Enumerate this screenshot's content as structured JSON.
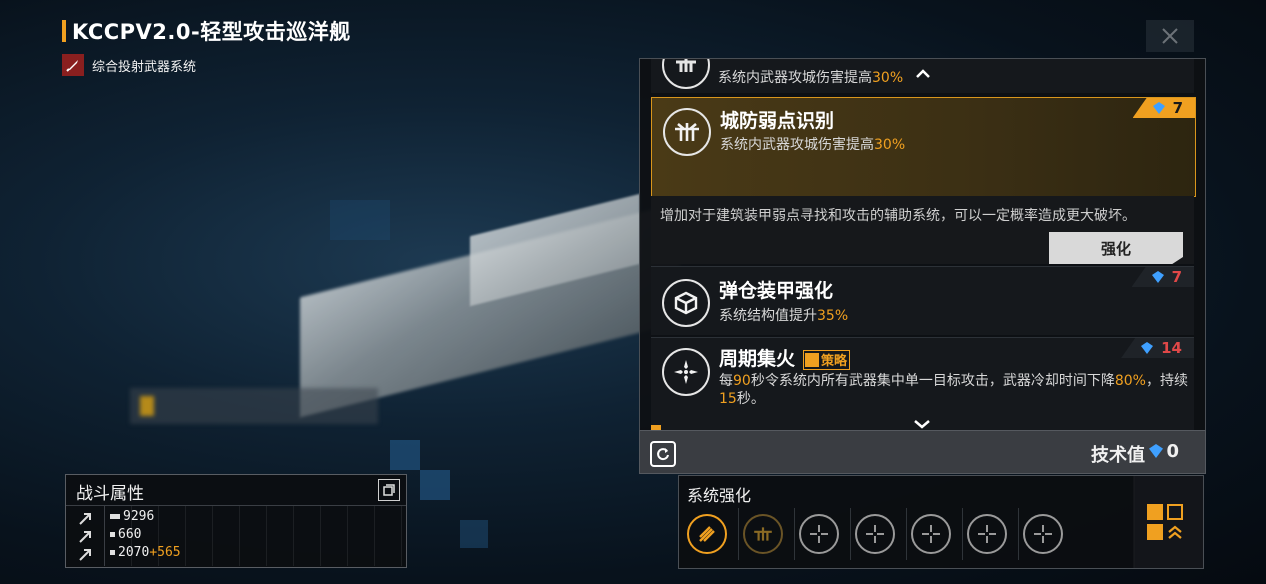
{
  "header": {
    "title": "KCCPV2.0-轻型攻击巡洋舰",
    "subtitle": "综合投射武器系统",
    "subtitle_icon": "missile-icon",
    "close_icon": "close-icon"
  },
  "skills_panel": {
    "prev_item": {
      "desc_prefix": "系统内武器攻城伤害提高",
      "desc_value": "30%"
    },
    "selected": {
      "name": "城防弱点识别",
      "desc_prefix": "系统内武器攻城伤害提高",
      "desc_value": "30%",
      "cost": "7",
      "long_desc": "增加对于建筑装甲弱点寻找和攻击的辅助系统，可以一定概率造成更大破坏。",
      "upgrade_label": "强化"
    },
    "items": [
      {
        "name": "弹仓装甲强化",
        "desc_prefix": "系统结构值提升",
        "desc_value": "35%",
        "cost": "7"
      },
      {
        "name": "周期集火",
        "tag": "策略",
        "cost": "14",
        "desc_1": "每",
        "desc_v1": "90",
        "desc_2": "秒令系统内所有武器集中单一目标攻击，武器冷却时间下降",
        "desc_v2": "80%",
        "desc_3": "，持续",
        "desc_v3": "15",
        "desc_4": "秒。"
      }
    ]
  },
  "tech_bar": {
    "label": "技术值",
    "value": "0",
    "refresh_icon": "refresh-icon"
  },
  "system_upgrade": {
    "title": "系统强化",
    "slots": [
      "missile-slot-icon",
      "crosshair-slot-icon",
      "empty-slot-icon",
      "empty-slot-icon",
      "empty-slot-icon",
      "empty-slot-icon",
      "empty-slot-icon"
    ]
  },
  "combat_stats": {
    "title": "战斗属性",
    "stats": [
      {
        "value": "9296",
        "bonus": ""
      },
      {
        "value": "660",
        "bonus": ""
      },
      {
        "value": "2070",
        "bonus": "+565"
      }
    ]
  },
  "colors": {
    "accent": "#f0a020",
    "gem_blue": "#3fa0ff",
    "cost_red": "#e04848"
  }
}
